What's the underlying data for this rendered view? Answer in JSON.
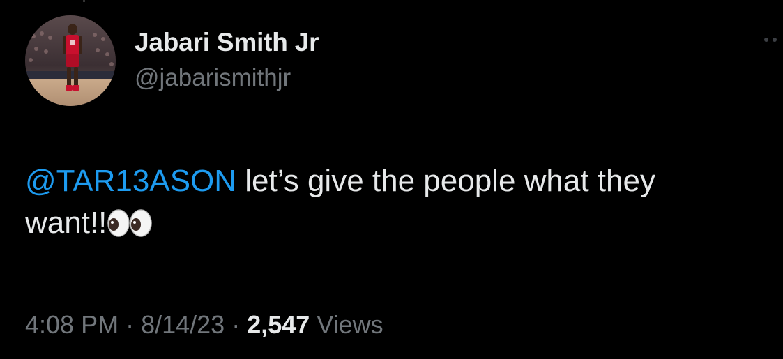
{
  "author": {
    "display_name": "Jabari Smith Jr",
    "handle": "@jabarismithjr",
    "avatar_icon": "player-photo-avatar"
  },
  "tweet": {
    "mention": "@TAR13ASON",
    "text_line1": " let’s give the people what they",
    "text_line2": "want!!",
    "emoji": "eyes-emoji"
  },
  "meta": {
    "time": "4:08 PM",
    "separator1": " · ",
    "date": "8/14/23",
    "separator2": " · ",
    "views_count": "2,547",
    "views_label": " Views"
  },
  "colors": {
    "background": "#000000",
    "primary_text": "#e7e9ea",
    "secondary_text": "#71767b",
    "mention": "#1d9bf0"
  }
}
